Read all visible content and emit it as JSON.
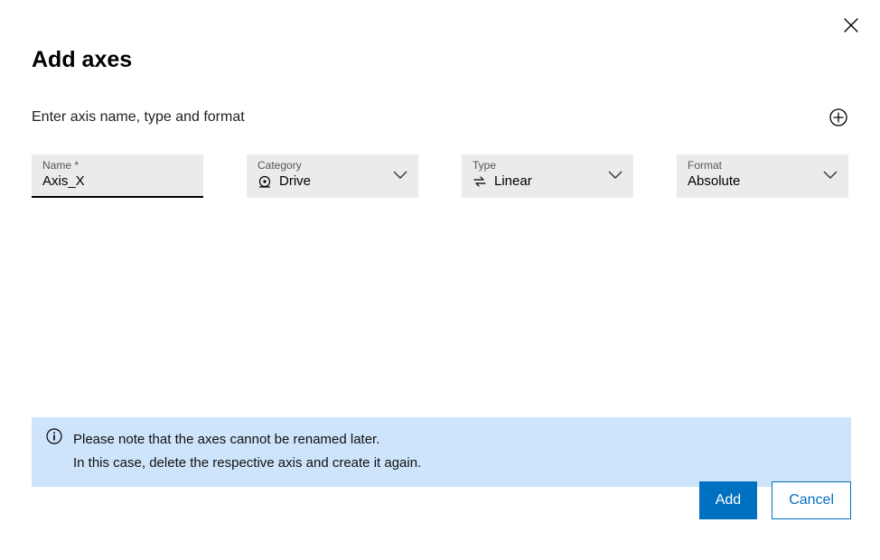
{
  "dialog": {
    "title": "Add axes",
    "subtitle": "Enter axis name, type and format"
  },
  "fields": {
    "name": {
      "label": "Name *",
      "value": "Axis_X"
    },
    "category": {
      "label": "Category",
      "value": "Drive"
    },
    "type": {
      "label": "Type",
      "value": "Linear"
    },
    "format": {
      "label": "Format",
      "value": "Absolute"
    }
  },
  "info": {
    "line1": "Please note that the axes cannot be renamed later.",
    "line2": "In this case, delete the respective axis and create it again."
  },
  "buttons": {
    "add": "Add",
    "cancel": "Cancel"
  }
}
